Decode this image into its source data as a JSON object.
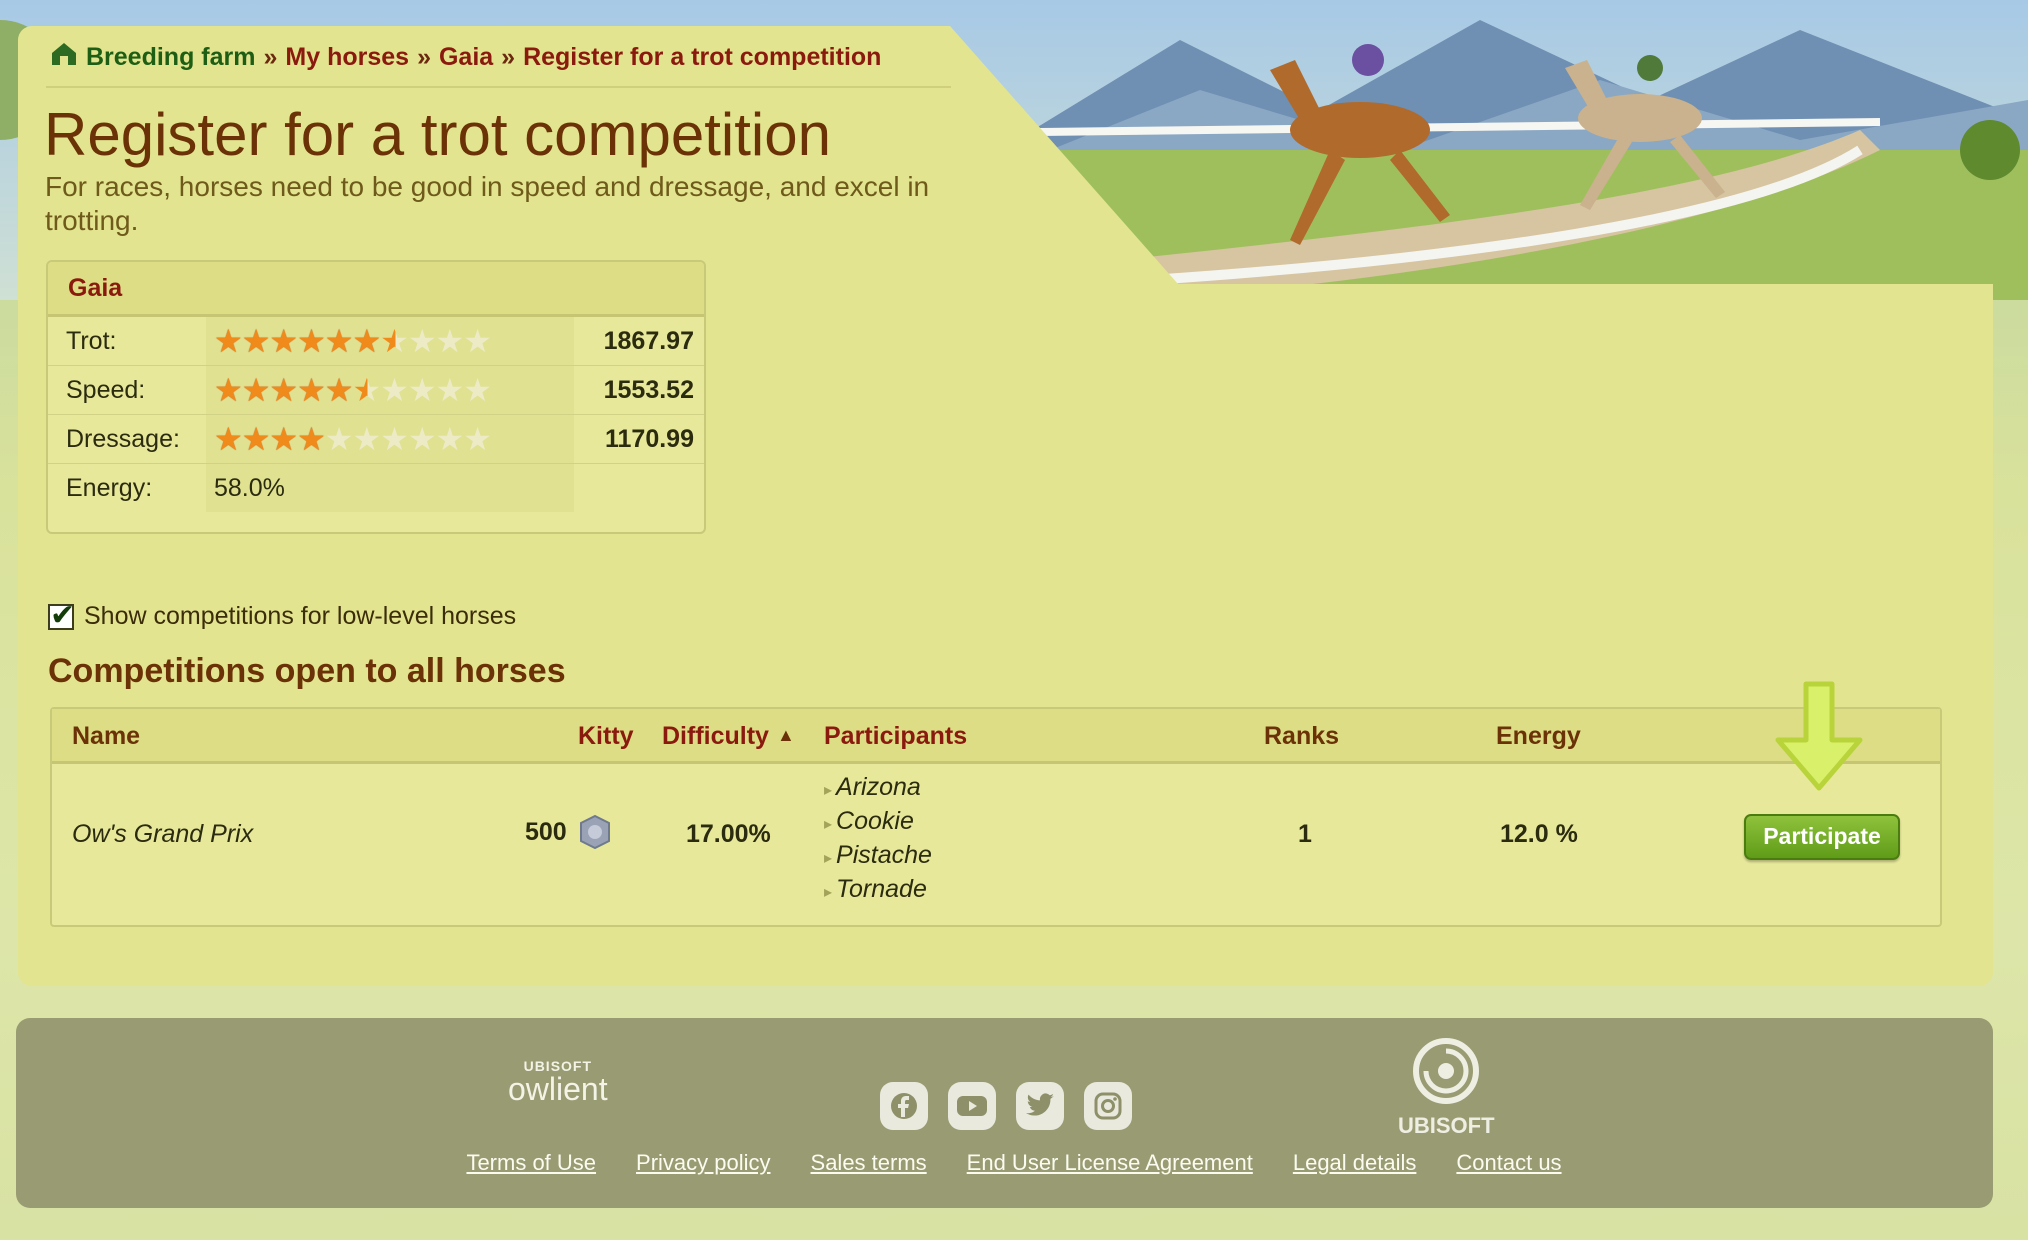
{
  "breadcrumb": {
    "items": [
      "Breeding farm",
      "My horses",
      "Gaia",
      "Register for a trot competition"
    ],
    "separator": "»"
  },
  "page": {
    "title": "Register for a trot competition",
    "subtitle": "For races, horses need to be good in speed and dressage, and excel in trotting."
  },
  "horse": {
    "name": "Gaia",
    "stats": [
      {
        "label": "Trot:",
        "stars_filled": 6.5,
        "stars_total": 10,
        "value": "1867.97"
      },
      {
        "label": "Speed:",
        "stars_filled": 5.5,
        "stars_total": 10,
        "value": "1553.52"
      },
      {
        "label": "Dressage:",
        "stars_filled": 4,
        "stars_total": 10,
        "value": "1170.99"
      }
    ],
    "energy_label": "Energy:",
    "energy_value": "58.0%"
  },
  "filters": {
    "low_level_label": "Show competitions for low-level horses",
    "low_level_checked": true
  },
  "competitions": {
    "section_title": "Competitions open to all horses",
    "columns": {
      "name": "Name",
      "kitty": "Kitty",
      "difficulty": "Difficulty",
      "participants": "Participants",
      "ranks": "Ranks",
      "energy": "Energy"
    },
    "sort_indicator": "▲",
    "rows": [
      {
        "name": "Ow's Grand Prix",
        "kitty": "500",
        "difficulty": "17.00%",
        "participants": [
          "Arizona",
          "Cookie",
          "Pistache",
          "Tornade"
        ],
        "ranks": "1",
        "energy": "12.0 %",
        "action": "Participate"
      }
    ]
  },
  "footer": {
    "owlient_small": "UBISOFT",
    "owlient_big": "owlient",
    "ubisoft_word": "UBISOFT",
    "social": [
      "facebook-icon",
      "youtube-icon",
      "twitter-icon",
      "instagram-icon"
    ],
    "links": [
      "Terms of Use",
      "Privacy policy",
      "Sales terms",
      "End User License Agreement",
      "Legal details",
      "Contact us"
    ]
  },
  "colors": {
    "panel": "#e3e48f",
    "title": "#6a3206",
    "link_red": "#8a1a0e",
    "button_green": "#6aa71f",
    "footer": "#999b73"
  }
}
